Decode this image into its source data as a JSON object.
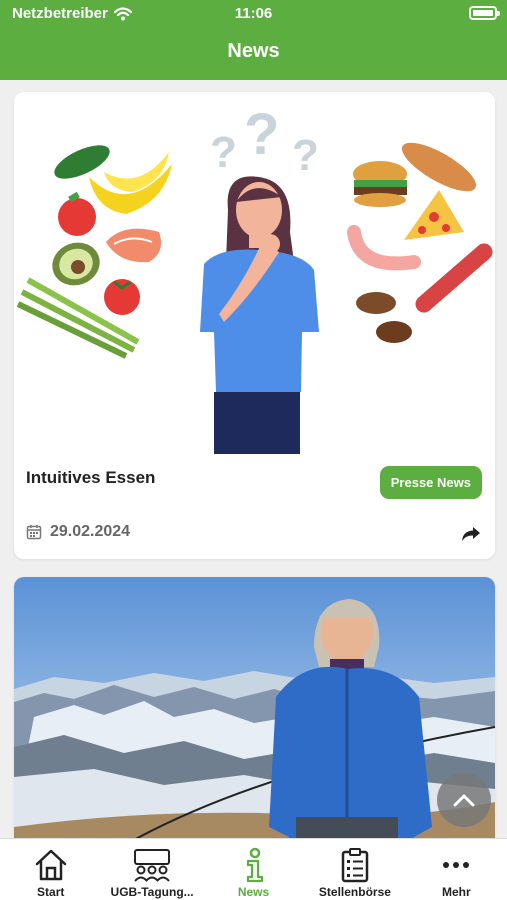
{
  "status_bar": {
    "carrier": "Netzbetreiber",
    "time": "11:06"
  },
  "header": {
    "title": "News"
  },
  "news": [
    {
      "title": "Intuitives Essen",
      "tag": "Presse News",
      "date": "29.02.2024"
    }
  ],
  "tabbar": {
    "items": [
      {
        "label": "Start",
        "icon": "home-icon"
      },
      {
        "label": "UGB-Tagung...",
        "icon": "audience-icon"
      },
      {
        "label": "News",
        "icon": "info-icon",
        "active": true
      },
      {
        "label": "Stellenbörse",
        "icon": "clipboard-icon"
      },
      {
        "label": "Mehr",
        "icon": "more-icon"
      }
    ]
  },
  "colors": {
    "accent": "#5cae40",
    "background": "#efefef"
  }
}
